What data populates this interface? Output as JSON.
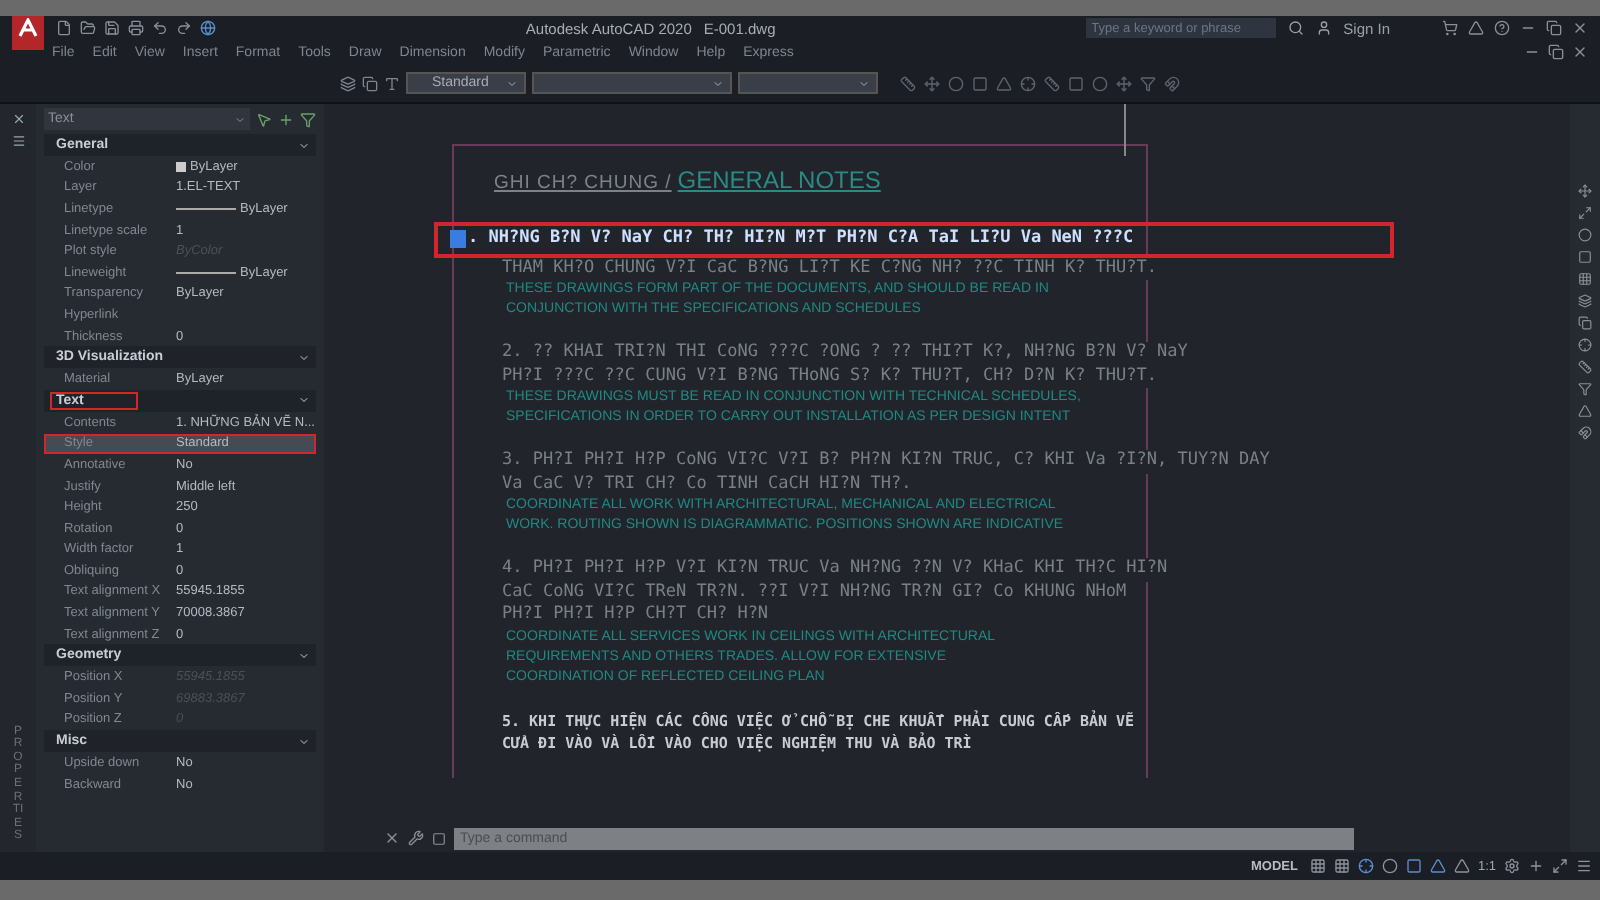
{
  "title_bar": {
    "app_title": "Autodesk AutoCAD 2020",
    "file": "E-001.dwg",
    "search_placeholder": "Type a keyword or phrase",
    "sign_in": "Sign In"
  },
  "menu": [
    "File",
    "Edit",
    "View",
    "Insert",
    "Format",
    "Tools",
    "Draw",
    "Dimension",
    "Modify",
    "Parametric",
    "Window",
    "Help",
    "Express"
  ],
  "toolbar": {
    "text_style": "Standard"
  },
  "properties": {
    "object_type": "Text",
    "side_label": "PROPERTIES",
    "sections": [
      {
        "title": "General",
        "highlighted": false,
        "rows": [
          {
            "label": "Color",
            "value": "ByLayer",
            "kind": "swatch",
            "disabled": false,
            "highlighted": false
          },
          {
            "label": "Layer",
            "value": "1.EL-TEXT",
            "kind": "text",
            "disabled": false,
            "highlighted": false
          },
          {
            "label": "Linetype",
            "value": "ByLayer",
            "kind": "line",
            "disabled": false,
            "highlighted": false
          },
          {
            "label": "Linetype scale",
            "value": "1",
            "kind": "text",
            "disabled": false,
            "highlighted": false
          },
          {
            "label": "Plot style",
            "value": "ByColor",
            "kind": "text",
            "disabled": true,
            "highlighted": false
          },
          {
            "label": "Lineweight",
            "value": "ByLayer",
            "kind": "line",
            "disabled": false,
            "highlighted": false
          },
          {
            "label": "Transparency",
            "value": "ByLayer",
            "kind": "text",
            "disabled": false,
            "highlighted": false
          },
          {
            "label": "Hyperlink",
            "highlighted": false
          },
          {
            "label": "Thickness",
            "value": "0",
            "kind": "text",
            "disabled": false,
            "highlighted": false
          }
        ]
      },
      {
        "title": "3D Visualization",
        "highlighted": false,
        "rows": [
          {
            "label": "Material",
            "value": "ByLayer",
            "kind": "text",
            "disabled": false,
            "highlighted": false
          }
        ]
      },
      {
        "title": "Text",
        "highlighted": true,
        "rows": [
          {
            "label": "Contents",
            "value": "1. NHỮNG BẢN VẼ N...",
            "kind": "text",
            "disabled": false,
            "highlighted": false
          },
          {
            "label": "Style",
            "value": "Standard",
            "kind": "text",
            "disabled": false,
            "highlighted": true
          },
          {
            "label": "Annotative",
            "value": "No",
            "kind": "text",
            "disabled": false,
            "highlighted": false
          },
          {
            "label": "Justify",
            "value": "Middle left",
            "kind": "text",
            "disabled": false,
            "highlighted": false
          },
          {
            "label": "Height",
            "value": "250",
            "kind": "text",
            "disabled": false,
            "highlighted": false
          },
          {
            "label": "Rotation",
            "value": "0",
            "kind": "text",
            "disabled": false,
            "highlighted": false
          },
          {
            "label": "Width factor",
            "value": "1",
            "kind": "text",
            "disabled": false,
            "highlighted": false
          },
          {
            "label": "Obliquing",
            "value": "0",
            "kind": "text",
            "disabled": false,
            "highlighted": false
          },
          {
            "label": "Text alignment X",
            "value": "55945.1855",
            "kind": "text",
            "disabled": false,
            "highlighted": false
          },
          {
            "label": "Text alignment Y",
            "value": "70008.3867",
            "kind": "text",
            "disabled": false,
            "highlighted": false
          },
          {
            "label": "Text alignment Z",
            "value": "0",
            "kind": "text",
            "disabled": false,
            "highlighted": false
          }
        ]
      },
      {
        "title": "Geometry",
        "highlighted": false,
        "rows": [
          {
            "label": "Position X",
            "value": "55945.1855",
            "kind": "text",
            "disabled": true,
            "highlighted": false
          },
          {
            "label": "Position Y",
            "value": "69883.3867",
            "kind": "text",
            "disabled": true,
            "highlighted": false
          },
          {
            "label": "Position Z",
            "value": "0",
            "kind": "text",
            "disabled": true,
            "highlighted": false
          }
        ]
      },
      {
        "title": "Misc",
        "highlighted": false,
        "rows": [
          {
            "label": "Upside down",
            "value": "No",
            "kind": "text",
            "disabled": false,
            "highlighted": false
          },
          {
            "label": "Backward",
            "value": "No",
            "kind": "text",
            "disabled": false,
            "highlighted": false
          }
        ]
      }
    ]
  },
  "drawing": {
    "heading_vi": "GHI CH? CHUNG /",
    "heading_en": "GENERAL NOTES",
    "notes": [
      {
        "selected": true,
        "kind": "shx",
        "vi_lines": [
          ". NH?NG B?N V? NaY CH? TH? HI?N M?T PH?N C?A TaI  LI?U Va NeN ???C",
          "THAM KH?O CHUNG V?I CaC B?NG LI?T KE C?NG NH? ??C TINH K? THU?T."
        ],
        "en_lines": [
          "THESE DRAWINGS FORM PART OF THE DOCUMENTS, AND SHOULD BE READ IN",
          "CONJUNCTION WITH THE SPECIFICATIONS AND SCHEDULES"
        ]
      },
      {
        "selected": false,
        "kind": "shx",
        "vi_lines": [
          "2. ?? KHAI TRI?N THI CoNG ???C ?ONG ? ?? THI?T K?, NH?NG B?N V? NaY",
          "PH?I ???C ??C CUNG V?I B?NG THoNG S? K? THU?T, CH? D?N K? THU?T."
        ],
        "en_lines": [
          "THESE DRAWINGS MUST BE READ IN CONJUNCTION WITH TECHNICAL SCHEDULES,",
          "SPECIFICATIONS IN ORDER TO CARRY OUT INSTALLATION AS PER DESIGN INTENT"
        ]
      },
      {
        "selected": false,
        "kind": "shx",
        "vi_lines": [
          "3. PH?I PH?I H?P CoNG VI?C V?I B? PH?N KI?N TRUC, C? KHI Va ?I?N, TUY?N DAY",
          "Va CaC V? TRI CH? Co TINH CaCH HI?N TH?."
        ],
        "en_lines": [
          "COORDINATE ALL WORK WITH ARCHITECTURAL, MECHANICAL AND ELECTRICAL",
          "WORK. ROUTING SHOWN IS DIAGRAMMATIC. POSITIONS SHOWN ARE INDICATIVE"
        ]
      },
      {
        "selected": false,
        "kind": "shx",
        "vi_lines": [
          "4. PH?I PH?I H?P V?I KI?N TRUC Va NH?NG ??N V? KHaC KHI TH?C HI?N",
          "CaC CoNG VI?C TReN TR?N. ??I V?I NH?NG TR?N GI? Co KHUNG NHoM",
          "PH?I PH?I H?P CH?T CH? H?N"
        ],
        "en_lines": [
          "COORDINATE ALL SERVICES WORK IN CEILINGS WITH ARCHITECTURAL",
          "REQUIREMENTS AND OTHERS TRADES. ALLOW FOR EXTENSIVE",
          "COORDINATION OF REFLECTED CEILING PLAN"
        ]
      },
      {
        "selected": false,
        "kind": "unicode",
        "vi_lines": [
          "5. KHI THỰC HIỆN CÁC CÔNG VIỆC Ở CHỖ BỊ CHE KHUẤT PHẢI CUNG CẤP BẢN VẼ",
          "CỬA ĐI VÀO VÀ LỐI VÀO CHO VIỆC NGHIỆM THU VÀ BẢO TRÌ"
        ]
      }
    ]
  },
  "command_line": {
    "placeholder": "Type a command"
  },
  "status_bar": {
    "model": "MODEL",
    "scale": "1:1"
  }
}
